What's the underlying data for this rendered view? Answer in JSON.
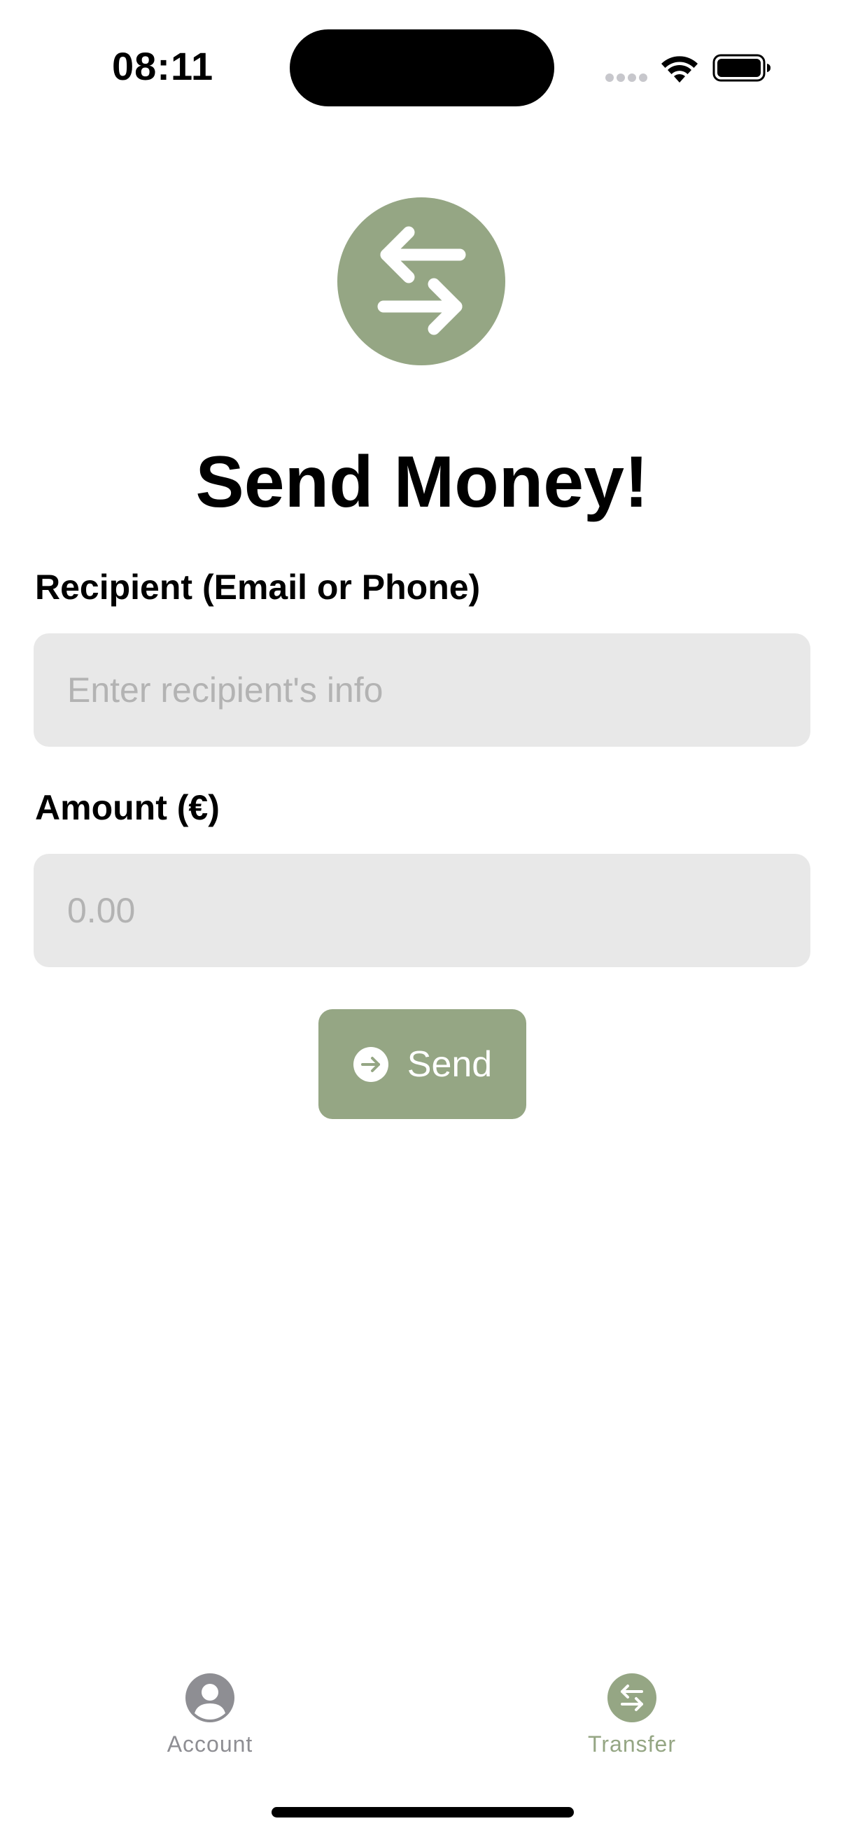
{
  "status_bar": {
    "time": "08:11"
  },
  "title": "Send Money!",
  "form": {
    "recipient_label": "Recipient (Email or Phone)",
    "recipient_placeholder": "Enter recipient's info",
    "amount_label": "Amount (€)",
    "amount_placeholder": "0.00"
  },
  "send_button": {
    "label": "Send",
    "icon": "arrow-right-circle-icon"
  },
  "tab_bar": {
    "items": [
      {
        "label": "Account",
        "icon": "person-circle-icon",
        "active": false
      },
      {
        "label": "Transfer",
        "icon": "transfer-arrows-icon",
        "active": true
      }
    ]
  },
  "colors": {
    "accent": "#95a684",
    "field_background": "#e8e8e8",
    "placeholder": "#b3b3b3",
    "inactive_tab": "#8e8e93"
  }
}
